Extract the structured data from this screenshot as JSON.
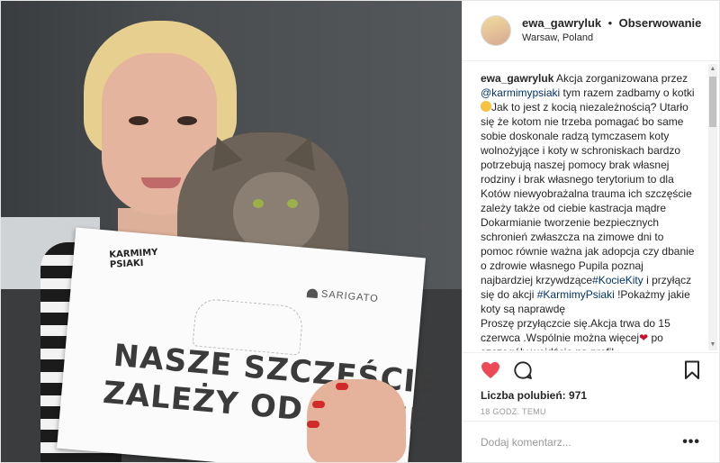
{
  "header": {
    "username": "ewa_gawryluk",
    "separator": "•",
    "follow_label": "Obserwowanie",
    "location": "Warsaw, Poland"
  },
  "photo": {
    "sign_logo_line1": "KARMIMY",
    "sign_logo_line2": "PSIAKI",
    "sign_brand": "SARIGATO",
    "sign_text_line1": "NASZE SZCZĘŚCIE",
    "sign_text_line2": "ZALEŻY OD CIEBIE"
  },
  "caption": {
    "author": "ewa_gawryluk",
    "p1": "Akcja zorganizowana przez",
    "mention": "@karmimypsiaki",
    "p2": "tym razem zadbamy o kotki",
    "p3": "Jak to jest z kocią niezależnością? Utarło się że kotom nie trzeba pomagać bo same sobie doskonale radzą tymczasem koty wolnożyjące i koty w schroniskach bardzo potrzebują naszej pomocy brak własnej rodziny i brak własnego terytorium to dla Kotów niewyobrażalna trauma ich szczęście zależy także od ciebie kastracja mądre Dokarmianie tworzenie bezpiecznych schronień zwłaszcza na zimowe dni to pomoc równie ważna jak adopcja czy dbanie o zdrowie własnego Pupila poznaj najbardziej krzywdzące",
    "hashtag1": "#KocieKity",
    "p4": "i przyłącz się do akcji",
    "hashtag2": "#KarmimyPsiaki",
    "p5": "!Pokażmy jakie koty są naprawdę",
    "p6": "Proszę przyłączcie się.Akcja trwa do 15 czerwca .Wspólnie można więcej",
    "p7": "po szczegóły wejdźcie na profil"
  },
  "actions": {
    "like_icon": "heart-icon",
    "comment_icon": "comment-icon",
    "save_icon": "bookmark-icon",
    "likes_label": "Liczba polubień:",
    "likes_count": "971",
    "time": "18 GODZ. TEMU"
  },
  "add_comment": {
    "placeholder": "Dodaj komentarz...",
    "more_label": "•••"
  },
  "colors": {
    "like_red": "#ed4956",
    "link": "#003569",
    "muted": "#999999"
  }
}
